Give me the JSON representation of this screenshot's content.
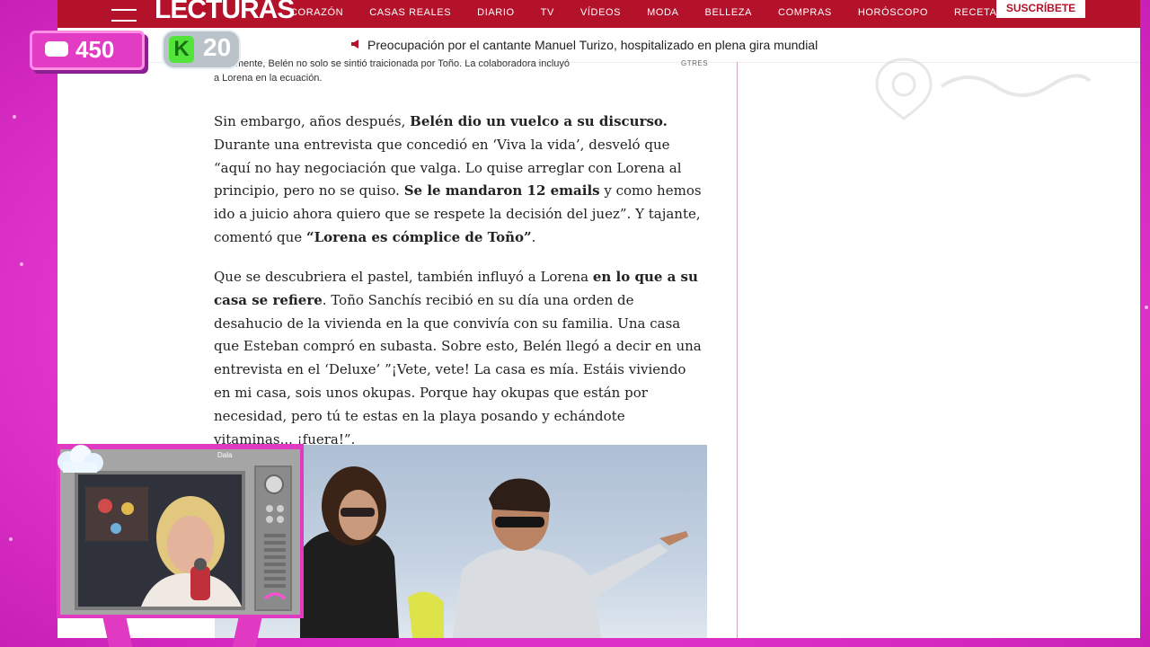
{
  "nav": {
    "logo": "LECTURAS",
    "items": [
      "CORAZÓN",
      "CASAS REALES",
      "DIARIO",
      "TV",
      "VÍDEOS",
      "MODA",
      "BELLEZA",
      "COMPRAS",
      "HORÓSCOPO",
      "RECETAS"
    ],
    "subscribe": "SUSCRÍBETE"
  },
  "ticker": {
    "icon": "megaphone-icon",
    "text": "Preocupación por el cantante Manuel Turizo, hospitalizado en plena gira mundial"
  },
  "caption": {
    "text": "Finalmente, Belén no solo se sintió traicionada por Toño. La colaboradora incluyó a Lorena en la ecuación.",
    "credit": "GTRES"
  },
  "article": {
    "p1": [
      {
        "t": "Sin embargo, años después, ",
        "b": false
      },
      {
        "t": "Belén dio un vuelco a su discurso.",
        "b": true
      },
      {
        "t": " Durante una entrevista que concedió en ‘Viva la vida’, desveló que “aquí no hay negociación que valga. Lo quise arreglar con Lorena al principio, pero no se quiso. ",
        "b": false
      },
      {
        "t": "Se le mandaron 12 emails",
        "b": true
      },
      {
        "t": " y como hemos ido a juicio ahora quiero que se respete la decisión del juez”. Y tajante, comentó que ",
        "b": false
      },
      {
        "t": "“Lorena es cómplice de Toño”",
        "b": true
      },
      {
        "t": ".",
        "b": false
      }
    ],
    "p2": [
      {
        "t": "Que se descubriera el pastel, también influyó a Lorena ",
        "b": false
      },
      {
        "t": "en lo que a su casa se refiere",
        "b": true
      },
      {
        "t": ". Toño Sanchís recibió en su día una orden de desahucio de la vivienda en la que convivía con su familia. Una casa que Esteban compró en subasta. Sobre esto, Belén llegó a decir en una entrevista en el ‘Deluxe’ ”¡Vete, vete! La casa es mía. Estáis viviendo en mi casa, sois unos okupas. Porque hay okupas que están por necesidad, pero tú te estas en la playa posando y echándote vitaminas... ¡fuera!”.",
        "b": false
      }
    ]
  },
  "overlay": {
    "chat_count": "450",
    "k_count": "20",
    "k_letter": "K",
    "chat_icon": "chat-bubble-icon",
    "tv_label": "Dala"
  },
  "colors": {
    "nav_bg": "#b3122a",
    "overlay_pink": "#e03ac3",
    "background": "#e63ad0"
  }
}
